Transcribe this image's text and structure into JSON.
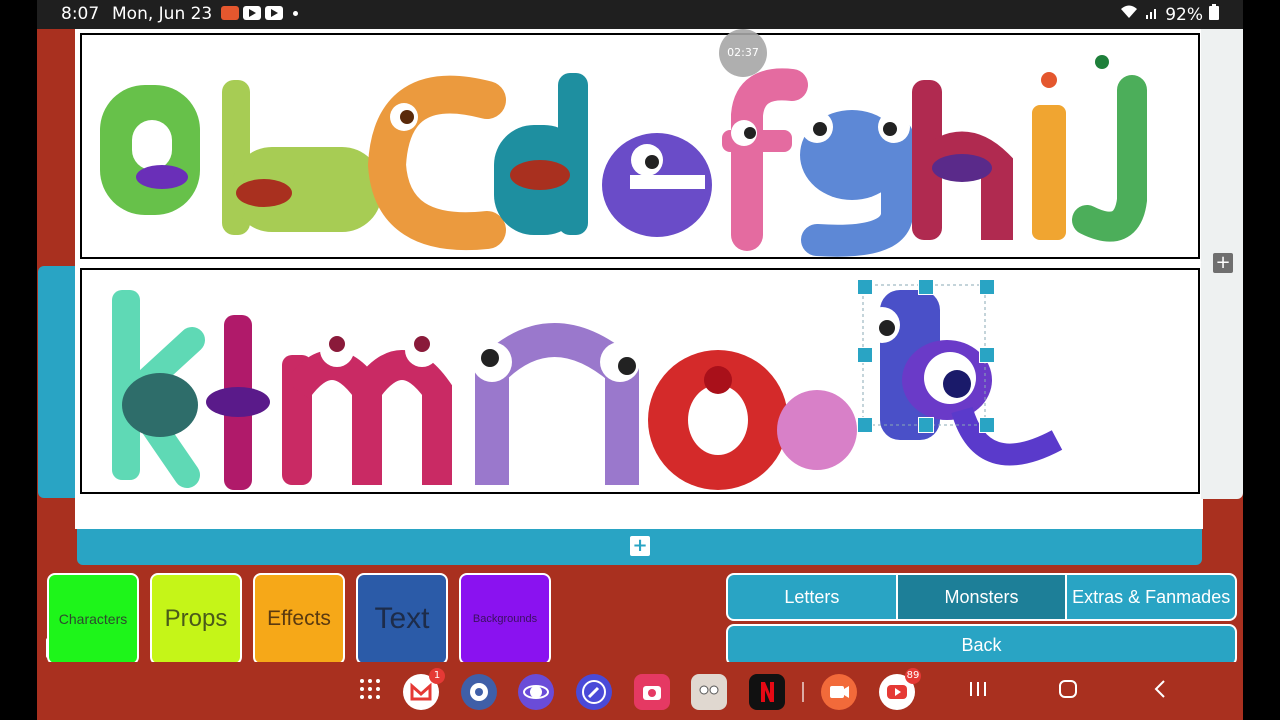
{
  "status_bar": {
    "time": "8:07",
    "date": "Mon, Jun 23",
    "battery": "92%"
  },
  "timer": "02:37",
  "strip1": {
    "letters": [
      "a",
      "b",
      "c",
      "d",
      "e",
      "f",
      "g",
      "h",
      "i",
      "j"
    ]
  },
  "strip2": {
    "letters": [
      "k",
      "l",
      "m",
      "n",
      "o",
      "p"
    ]
  },
  "categories": [
    {
      "label": "Characters",
      "color": "#1ef51a"
    },
    {
      "label": "Props",
      "color": "#c5f518"
    },
    {
      "label": "Effects",
      "color": "#f6a818"
    },
    {
      "label": "Text",
      "color": "#2b5ba8"
    },
    {
      "label": "Backgrounds",
      "color": "#8a12f0"
    }
  ],
  "tabs": [
    {
      "label": "Letters"
    },
    {
      "label": "Monsters",
      "active": true
    },
    {
      "label": "Extras & Fanmades"
    }
  ],
  "back_label": "Back",
  "nav_badges": {
    "gmail": "1",
    "youtube": "89"
  },
  "accent": "#29a4c4",
  "background": "#a9301f"
}
